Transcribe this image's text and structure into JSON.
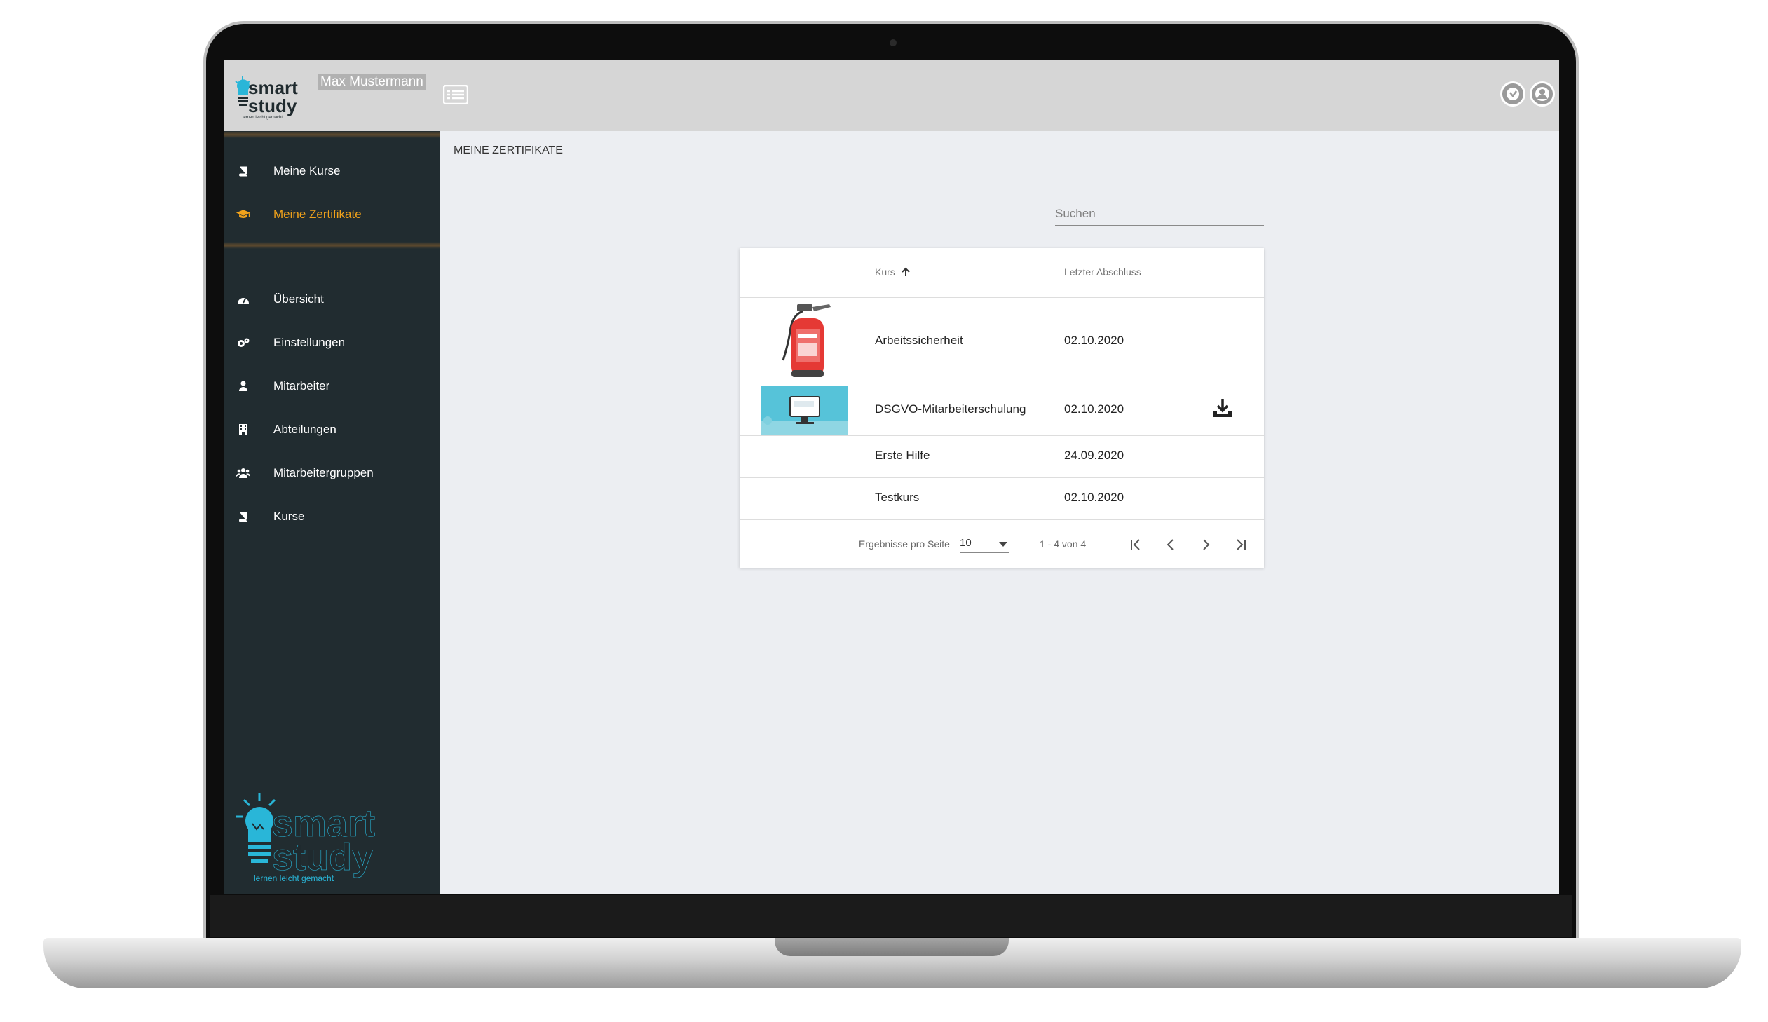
{
  "header": {
    "user_name": "Max Mustermann",
    "brand": {
      "word1": "smart",
      "word2": "study",
      "tagline": "lernen leicht gemacht"
    }
  },
  "sidebar": {
    "section1": [
      {
        "label": "Meine Kurse",
        "icon": "book-icon",
        "active": false
      },
      {
        "label": "Meine Zertifikate",
        "icon": "graduation-cap-icon",
        "active": true
      }
    ],
    "section2": [
      {
        "label": "Übersicht",
        "icon": "dashboard-icon"
      },
      {
        "label": "Einstellungen",
        "icon": "cogs-icon"
      },
      {
        "label": "Mitarbeiter",
        "icon": "user-icon"
      },
      {
        "label": "Abteilungen",
        "icon": "building-icon"
      },
      {
        "label": "Mitarbeitergruppen",
        "icon": "users-icon"
      },
      {
        "label": "Kurse",
        "icon": "book-icon"
      }
    ]
  },
  "main": {
    "title": "MEINE ZERTIFIKATE",
    "search_placeholder": "Suchen",
    "table": {
      "columns": [
        "Kurs",
        "Letzter Abschluss"
      ],
      "rows": [
        {
          "kurs": "Arbeitssicherheit",
          "datum": "02.10.2020",
          "thumbnail": "fire-extinguisher-image",
          "downloadable": false
        },
        {
          "kurs": "DSGVO-Mitarbeiterschulung",
          "datum": "02.10.2020",
          "thumbnail": "computer-screen-image",
          "downloadable": true
        },
        {
          "kurs": "Erste Hilfe",
          "datum": "24.09.2020",
          "thumbnail": "",
          "downloadable": false
        },
        {
          "kurs": "Testkurs",
          "datum": "02.10.2020",
          "thumbnail": "",
          "downloadable": false
        }
      ]
    },
    "pagination": {
      "per_page_label": "Ergebnisse pro Seite",
      "per_page_value": "10",
      "range": "1 - 4 von 4"
    }
  },
  "colors": {
    "accent": "#f0a21b",
    "sidebar": "#212c30",
    "brand_blue": "#29b6d8",
    "topbar": "#d6d6d6"
  }
}
